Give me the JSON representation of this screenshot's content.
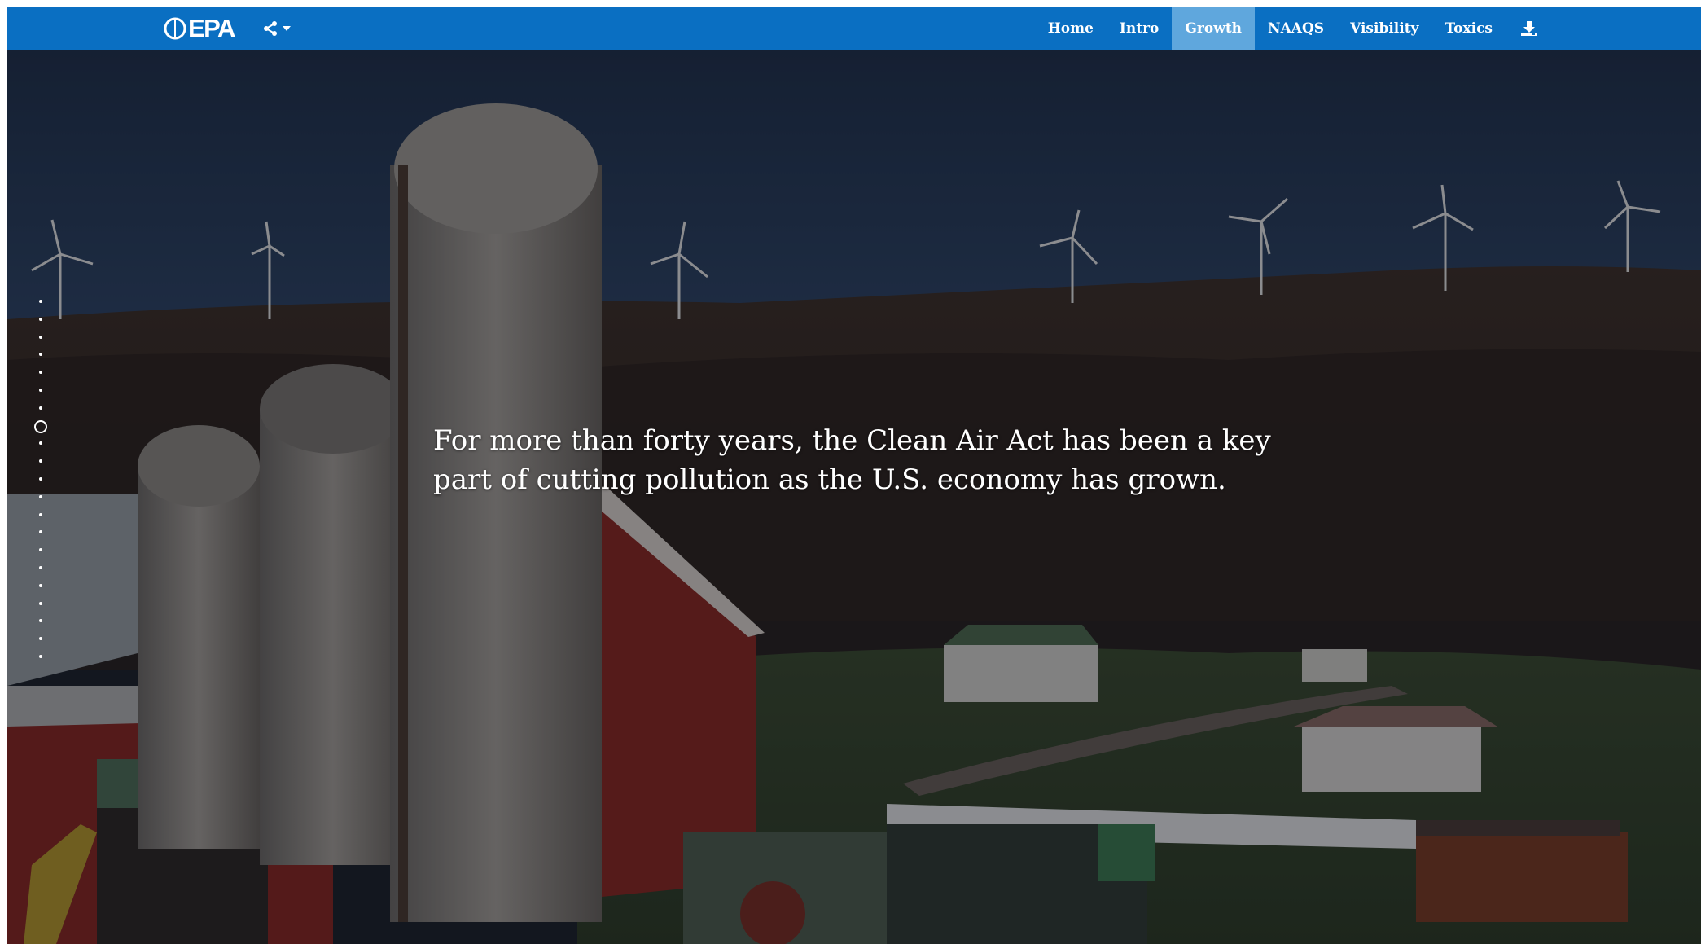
{
  "header": {
    "logo_text": "EPA",
    "share_icon": "share-icon",
    "nav": [
      {
        "label": "Home",
        "active": false
      },
      {
        "label": "Intro",
        "active": false
      },
      {
        "label": "Growth",
        "active": true
      },
      {
        "label": "NAAQS",
        "active": false
      },
      {
        "label": "Visibility",
        "active": false
      },
      {
        "label": "Toxics",
        "active": false
      }
    ],
    "download_icon": "download-icon",
    "colors": {
      "nav_bg": "#0a6fc2",
      "active_bg": "#5fa7dd"
    }
  },
  "hero": {
    "headline": "For more than forty years, the Clean Air Act has been a key part of cutting pollution as the U.S. economy has grown."
  },
  "dotnav": {
    "count": 21,
    "active_index": 7
  }
}
